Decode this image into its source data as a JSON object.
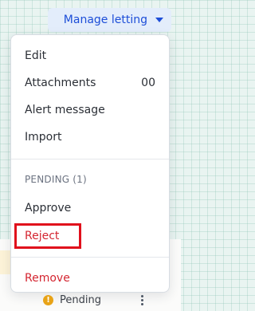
{
  "header": {
    "manage_letting_label": "Manage letting",
    "caret_icon": "caret-down-icon"
  },
  "menu": {
    "items_top": [
      {
        "label": "Edit"
      },
      {
        "label": "Attachments",
        "badge": "00"
      },
      {
        "label": "Alert message"
      },
      {
        "label": "Import"
      }
    ],
    "pending_heading": "PENDING (1)",
    "items_pending": [
      {
        "label": "Approve"
      },
      {
        "label": "Reject"
      }
    ],
    "remove_label": "Remove"
  },
  "status_row": {
    "label": "Pending",
    "icon": "warning-icon",
    "more_icon": "kebab-menu-icon"
  },
  "colors": {
    "accent": "#1d4ed8",
    "accent_bg": "#e3edfb",
    "danger": "#d42631",
    "highlight_border": "#e0101c",
    "warning": "#e8a317"
  }
}
